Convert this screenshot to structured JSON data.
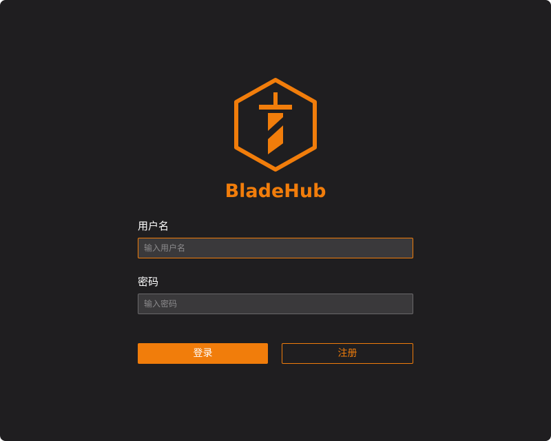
{
  "brand": {
    "name": "BladeHub",
    "accent_color": "#f17d0b",
    "logo_icon": "hexagon-sword-icon"
  },
  "login_form": {
    "username_label": "用户名",
    "username_placeholder": "输入用户名",
    "username_value": "",
    "password_label": "密码",
    "password_placeholder": "输入密码",
    "password_value": "",
    "login_button": "登录",
    "register_button": "注册"
  },
  "colors": {
    "background": "#1f1e20",
    "input_background": "#3a393b",
    "input_border": "#6a696b",
    "focus_border": "#f17d0b"
  }
}
